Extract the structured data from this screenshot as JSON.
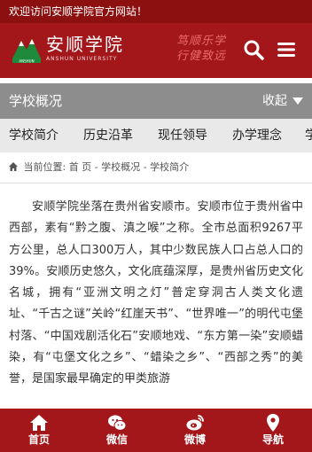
{
  "topbar": {
    "welcome": "欢迎访问安顺学院官方网站！"
  },
  "header": {
    "logo_text": "安顺学院",
    "logo_subtext": "ANSHUN UNIVERSITY",
    "logo_seal": "安顺学院",
    "motto_line1": "笃顺乐学",
    "motto_line2": "行健致远",
    "search_icon": "search-icon",
    "menu_icon": "hamburger-menu-icon"
  },
  "section": {
    "title": "学校概况",
    "collapse_label": "收起"
  },
  "subnav": {
    "items": [
      "学校简介",
      "历史沿革",
      "现任领导",
      "办学理念",
      "学"
    ]
  },
  "breadcrumb": {
    "label": "当前位置: 首 页 - 学校概况 - 学校简介"
  },
  "article": {
    "text": "安顺学院坐落在贵州省安顺市。安顺市位于贵州省中西部，素有“黔之腹、滇之喉”之称。全市总面积9267平方公里，总人口300万人，其中少数民族人口占总人口的39%。安顺历史悠久，文化底蕴深厚，是贵州省历史文化名城，拥有“亚洲文明之灯”普定穿洞古人类文化遗址、“千古之谜”关岭“红崖天书”、“世界唯一”的明代屯堡村落、“中国戏剧活化石”安顺地戏、“东方第一染”安顺蜡染，有“屯堡文化之乡”、“蜡染之乡”、“西部之秀”的美誉，是国家最早确定的甲类旅游"
  },
  "bottom_nav": {
    "items": [
      {
        "label": "首页",
        "icon": "home-icon"
      },
      {
        "label": "微信",
        "icon": "wechat-icon"
      },
      {
        "label": "微博",
        "icon": "weibo-icon"
      },
      {
        "label": "导航",
        "icon": "map-marker-icon"
      }
    ]
  },
  "colors": {
    "primary_red": "#a3161a",
    "topbar_red": "#8c1010",
    "section_gray": "#8d8d8d",
    "subnav_bg": "#e9e9e9"
  }
}
